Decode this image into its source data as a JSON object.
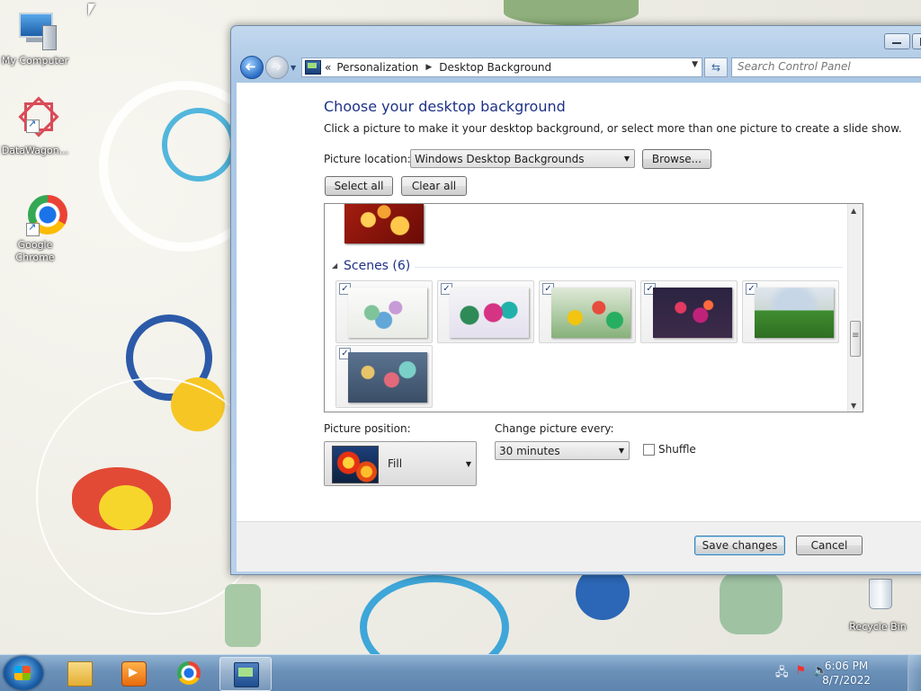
{
  "desktop": {
    "icons": [
      {
        "label": "My Computer"
      },
      {
        "label": "DataWagon..."
      },
      {
        "label": "Google Chrome"
      },
      {
        "label": "Recycle Bin"
      }
    ]
  },
  "window": {
    "breadcrumb": [
      "Personalization",
      "Desktop Background"
    ],
    "search_placeholder": "Search Control Panel",
    "heading": "Choose your desktop background",
    "subtitle": "Click a picture to make it your desktop background, or select more than one picture to create a slide show.",
    "picture_location_label": "Picture location:",
    "picture_location_value": "Windows Desktop Backgrounds",
    "browse_label": "Browse...",
    "select_all_label": "Select all",
    "clear_all_label": "Clear all",
    "group": {
      "label": "Scenes (6)",
      "checked_count": 6
    },
    "picture_position_label": "Picture position:",
    "picture_position_value": "Fill",
    "change_every_label": "Change picture every:",
    "change_every_value": "30 minutes",
    "shuffle_label": "Shuffle",
    "shuffle_checked": false,
    "save_label": "Save changes",
    "cancel_label": "Cancel"
  },
  "taskbar": {
    "items": [
      "windows-explorer",
      "windows-media-player",
      "google-chrome",
      "control-panel"
    ],
    "active_item": "control-panel",
    "time": "6:06 PM",
    "date": "8/7/2022"
  }
}
